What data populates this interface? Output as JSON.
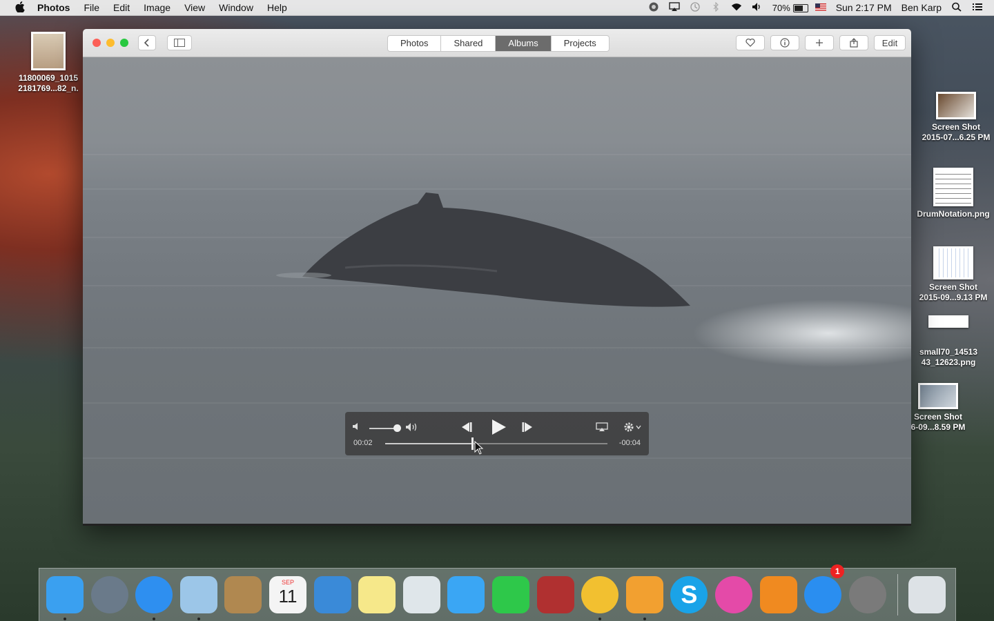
{
  "menubar": {
    "app_name": "Photos",
    "items": [
      "File",
      "Edit",
      "Image",
      "View",
      "Window",
      "Help"
    ],
    "battery_percent": "70%",
    "battery_level": 0.7,
    "clock": "Sun 2:17 PM",
    "user": "Ben Karp",
    "status_icons": [
      "creative-cloud-icon",
      "airplay-icon",
      "time-machine-icon",
      "bluetooth-icon",
      "wifi-icon",
      "volume-icon",
      "flag-icon",
      "spotlight-icon",
      "notification-center-icon"
    ]
  },
  "desktop": {
    "left_icon_label": "11800069_1015\n2181769...82_n.",
    "right_icons": [
      {
        "label": "Screen Shot\n2015-07...6.25 PM"
      },
      {
        "label": "DrumNotation.png"
      },
      {
        "label": "Screen Shot\n2015-09...9.13 PM"
      },
      {
        "label": "small70_14513\n43_12623.png"
      },
      {
        "label": "Screen Shot\n6-09...8.59 PM"
      }
    ]
  },
  "window": {
    "tabs": [
      {
        "label": "Photos",
        "active": false
      },
      {
        "label": "Shared",
        "active": false
      },
      {
        "label": "Albums",
        "active": true
      },
      {
        "label": "Projects",
        "active": false
      }
    ],
    "edit_label": "Edit",
    "traffic_colors": {
      "close": "#fc5f57",
      "minimize": "#fdbc2e",
      "zoom": "#28c840"
    }
  },
  "video": {
    "elapsed": "00:02",
    "remaining": "-00:04",
    "progress": 0.39,
    "volume": 0.95
  },
  "dock": {
    "apps": [
      {
        "name": "finder",
        "running": true,
        "color": "#3aa0f0"
      },
      {
        "name": "launchpad",
        "running": false,
        "color": "#6a7a8a"
      },
      {
        "name": "safari",
        "running": true,
        "color": "#2e8ff0"
      },
      {
        "name": "mail",
        "running": true,
        "color": "#9cc6e8"
      },
      {
        "name": "contacts",
        "running": false,
        "color": "#b08850"
      },
      {
        "name": "calendar",
        "running": false,
        "color": "#f4f4f4",
        "month": "SEP",
        "day": "11"
      },
      {
        "name": "keynote",
        "running": false,
        "color": "#3a8ad8"
      },
      {
        "name": "notes",
        "running": false,
        "color": "#f6e88a"
      },
      {
        "name": "preview",
        "running": false,
        "color": "#dfe6ea"
      },
      {
        "name": "messages",
        "running": false,
        "color": "#3aa6f4"
      },
      {
        "name": "facetime",
        "running": false,
        "color": "#2ec84a"
      },
      {
        "name": "photo-booth",
        "running": false,
        "color": "#b03030"
      },
      {
        "name": "photos",
        "running": true,
        "color": "#f2c030"
      },
      {
        "name": "pages",
        "running": true,
        "color": "#f2a030"
      },
      {
        "name": "skype",
        "running": false,
        "color": "#1aa3e8",
        "glyph": "S"
      },
      {
        "name": "itunes",
        "running": false,
        "color": "#e44aa8"
      },
      {
        "name": "ibooks",
        "running": false,
        "color": "#f08a20"
      },
      {
        "name": "app-store",
        "running": false,
        "color": "#2a8ef0",
        "badge": "1"
      },
      {
        "name": "system-preferences",
        "running": false,
        "color": "#7a7a7a"
      },
      {
        "name": "trash",
        "running": false,
        "color": "#dde2e6"
      }
    ]
  }
}
